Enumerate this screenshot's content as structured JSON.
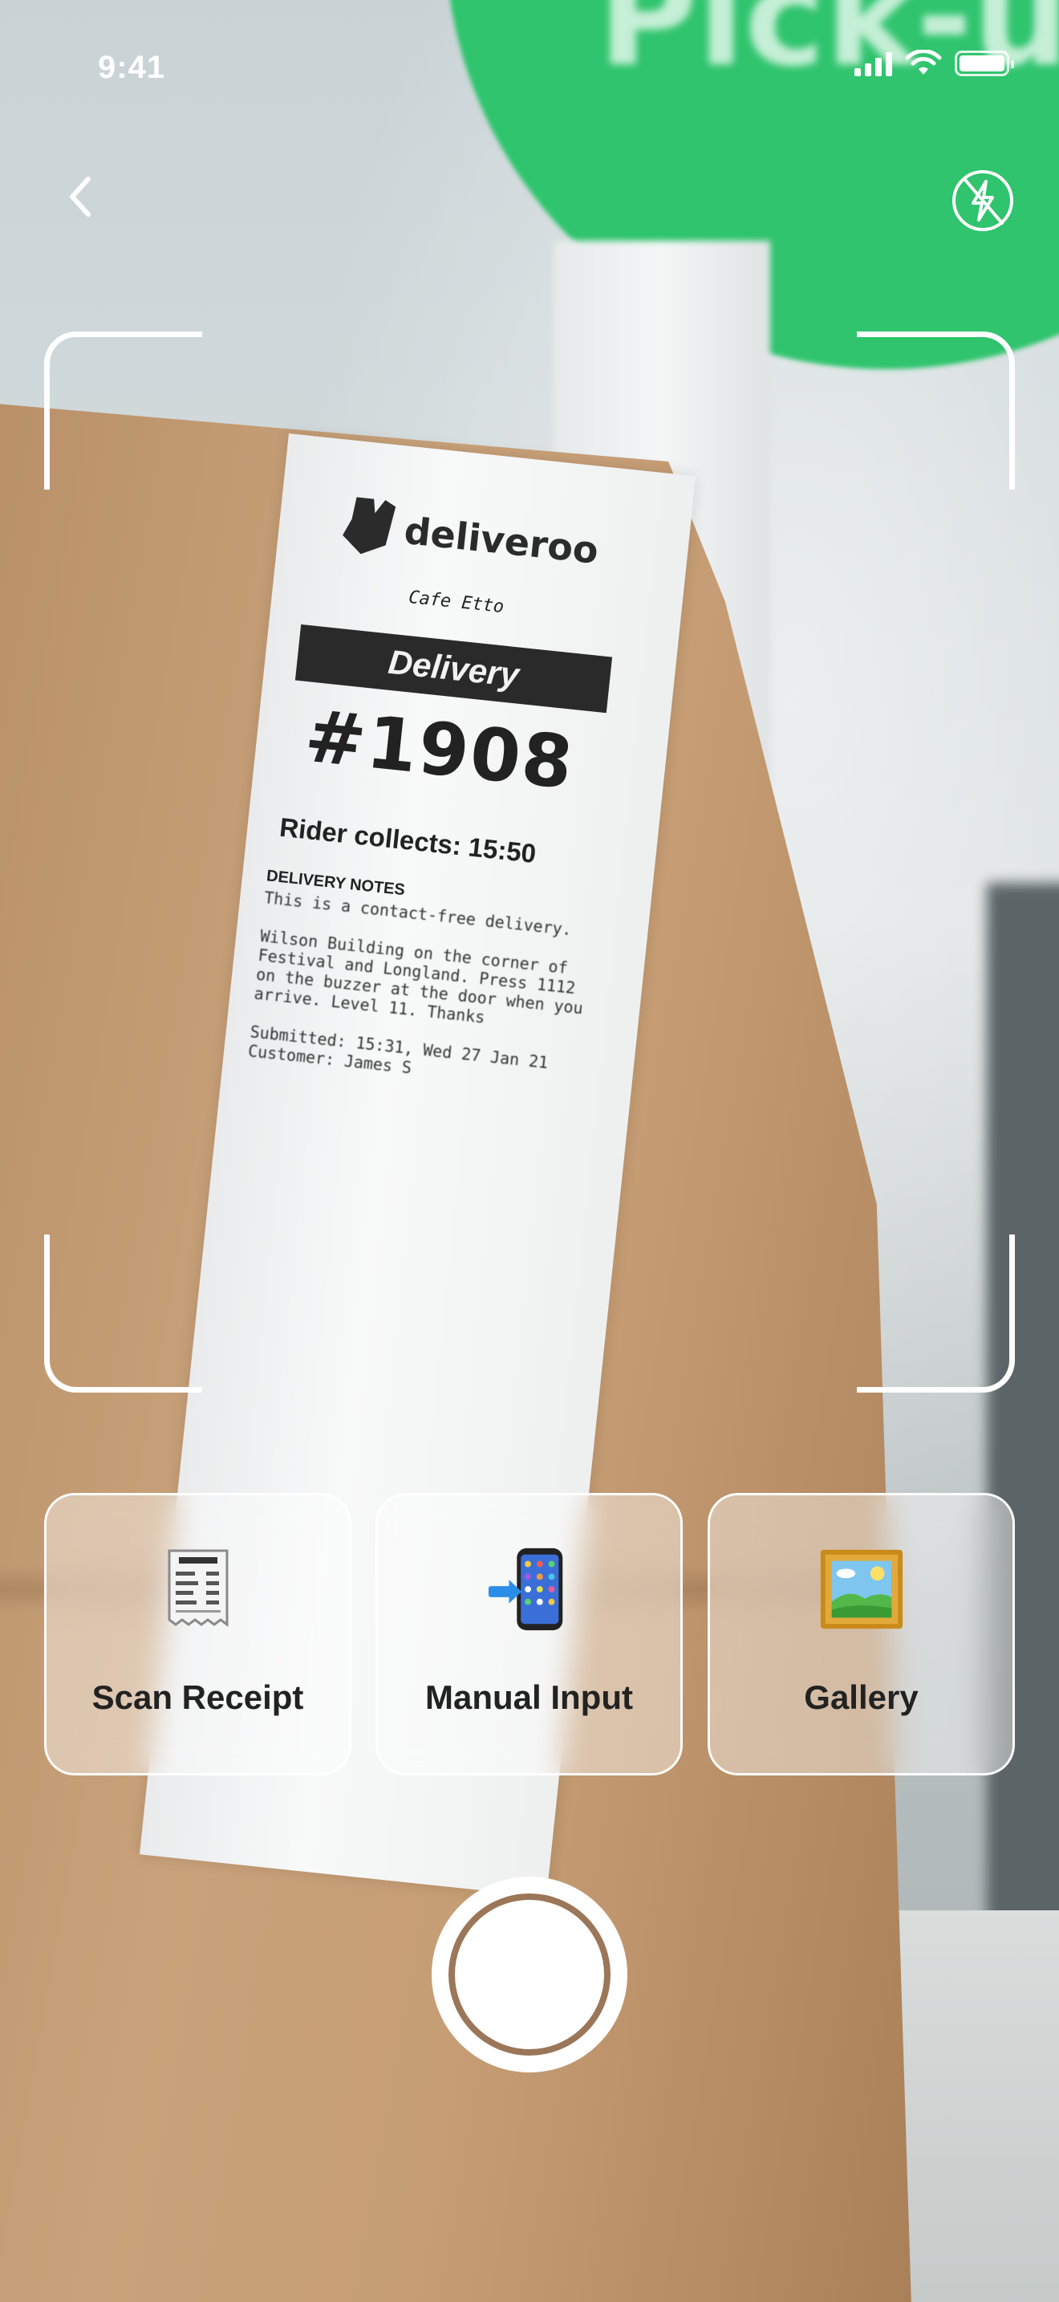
{
  "status_bar": {
    "time": "9:41"
  },
  "camera_view": {
    "background_sign_text": "Pick-up here",
    "receipt": {
      "brand": "deliveroo",
      "store": "Cafe Etto",
      "order_type": "Delivery",
      "order_number": "#1908",
      "rider_collects": "Rider collects: 15:50",
      "notes_title": "DELIVERY NOTES",
      "notes": "This is a contact-free delivery.\n\nWilson Building on the corner of Festival and Longland. Press 1112 on the buzzer at the door when you arrive. Level 11. Thanks\n\nSubmitted: 15:31, Wed 27 Jan 21\nCustomer: James S"
    }
  },
  "toolbar": {
    "back_icon": "chevron-left-icon",
    "flash_icon": "flash-off-icon"
  },
  "modes": [
    {
      "label": "Scan Receipt",
      "icon": "receipt-icon"
    },
    {
      "label": "Manual Input",
      "icon": "phone-arrow-icon"
    },
    {
      "label": "Gallery",
      "icon": "framed-picture-icon"
    }
  ],
  "colors": {
    "accent_green": "#2fc46d",
    "shutter_ring": "#9b7659",
    "label_text": "#222222"
  }
}
